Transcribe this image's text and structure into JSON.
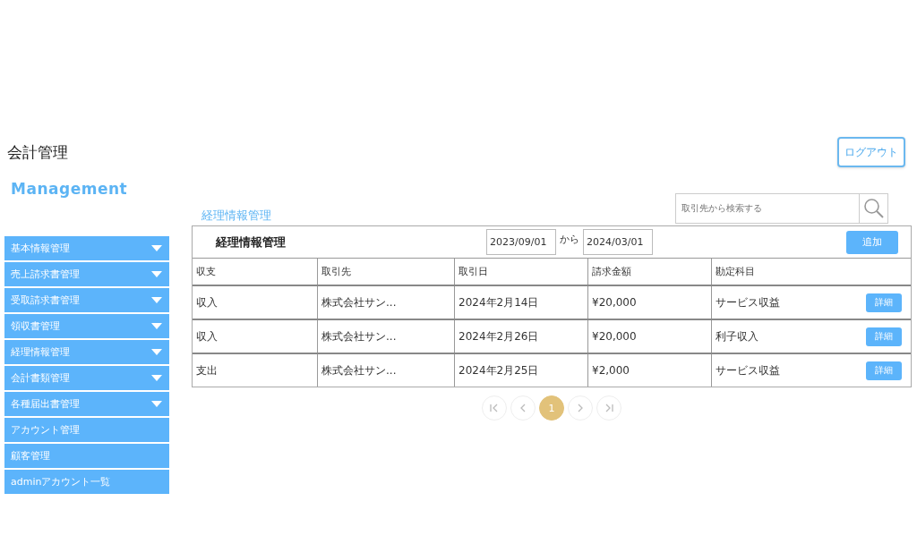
{
  "header": {
    "title": "会計管理",
    "logout_button": "ログアウト"
  },
  "sidebar": {
    "brand": "Management",
    "items": [
      {
        "label": "基本情報管理",
        "expandable": true
      },
      {
        "label": "売上請求書管理",
        "expandable": true
      },
      {
        "label": "受取請求書管理",
        "expandable": true
      },
      {
        "label": "領収書管理",
        "expandable": true
      },
      {
        "label": "経理情報管理",
        "expandable": true
      },
      {
        "label": "会計書類管理",
        "expandable": true
      },
      {
        "label": "各種届出書管理",
        "expandable": true
      },
      {
        "label": "アカウント管理",
        "expandable": false
      },
      {
        "label": "顧客管理",
        "expandable": false
      },
      {
        "label": "adminアカウント一覧",
        "expandable": false
      }
    ]
  },
  "page_title": "経理情報管理",
  "search": {
    "placeholder": "取引先から検索する"
  },
  "panel": {
    "title": "経理情報管理",
    "date_from": "2023/09/01",
    "separator": "から",
    "date_to": "2024/03/01",
    "add_button": "追加"
  },
  "table": {
    "columns": [
      "収支",
      "取引先",
      "取引日",
      "請求金額",
      "勘定科目"
    ],
    "rows": [
      {
        "cells": [
          "収入",
          "株式会社サン...",
          "2024年2月14日",
          "¥20,000",
          "サービス収益"
        ],
        "button": "詳細"
      },
      {
        "cells": [
          "収入",
          "株式会社サン...",
          "2024年2月26日",
          "¥20,000",
          "利子収入"
        ],
        "button": "詳細"
      },
      {
        "cells": [
          "支出",
          "株式会社サン...",
          "2024年2月25日",
          "¥2,000",
          "サービス収益"
        ],
        "button": "詳細"
      }
    ]
  },
  "pagination": [
    {
      "kind": "first",
      "selected": false
    },
    {
      "kind": "prev",
      "selected": false
    },
    {
      "kind": "page",
      "label": "1",
      "selected": true
    },
    {
      "kind": "next",
      "selected": false
    },
    {
      "kind": "last",
      "selected": false
    }
  ]
}
